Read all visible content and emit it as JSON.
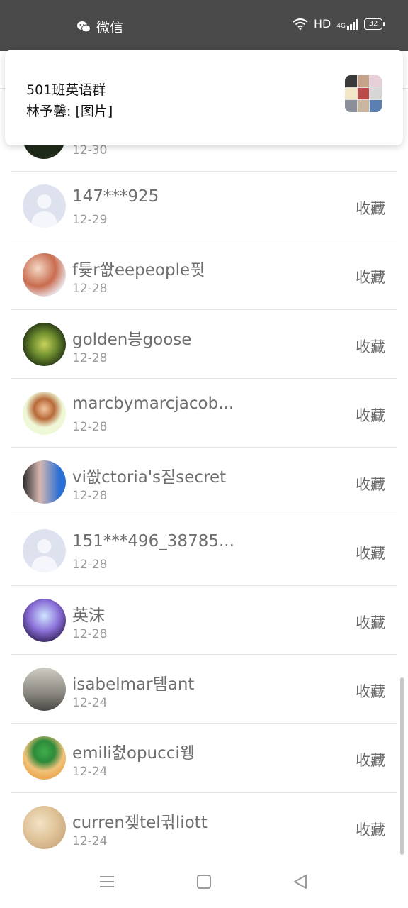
{
  "status_bar": {
    "app_name": "微信",
    "network_label": "HD",
    "signal_label": "4G",
    "battery_level": "32"
  },
  "notification": {
    "group_name": "501班英语群",
    "message": "林予馨: [图片]"
  },
  "peek": {
    "date": "12-30"
  },
  "rows": [
    {
      "name": "147***925",
      "date": "12-29",
      "action": "收藏"
    },
    {
      "name": "f튳r쐆eepeople퓟",
      "date": "12-28",
      "action": "收藏"
    },
    {
      "name": "golden븡goose",
      "date": "12-28",
      "action": "收藏"
    },
    {
      "name": "marcbymarcjacob...",
      "date": "12-28",
      "action": "收藏"
    },
    {
      "name": "vi쐆ctoria's짇secret",
      "date": "12-28",
      "action": "收藏"
    },
    {
      "name": "151***496_38785...",
      "date": "12-28",
      "action": "收藏"
    },
    {
      "name": "英沫",
      "date": "12-28",
      "action": "收藏"
    },
    {
      "name": "isabelmar템ant",
      "date": "12-24",
      "action": "收藏"
    },
    {
      "name": "emili첤opucci웽",
      "date": "12-24",
      "action": "收藏"
    },
    {
      "name": "curren젲tel귂liott",
      "date": "12-24",
      "action": "收藏"
    }
  ],
  "colors": {
    "status_bar_bg": "#4a4a4a",
    "text_primary": "#6e6e6e",
    "text_secondary": "#9a9a9a"
  }
}
